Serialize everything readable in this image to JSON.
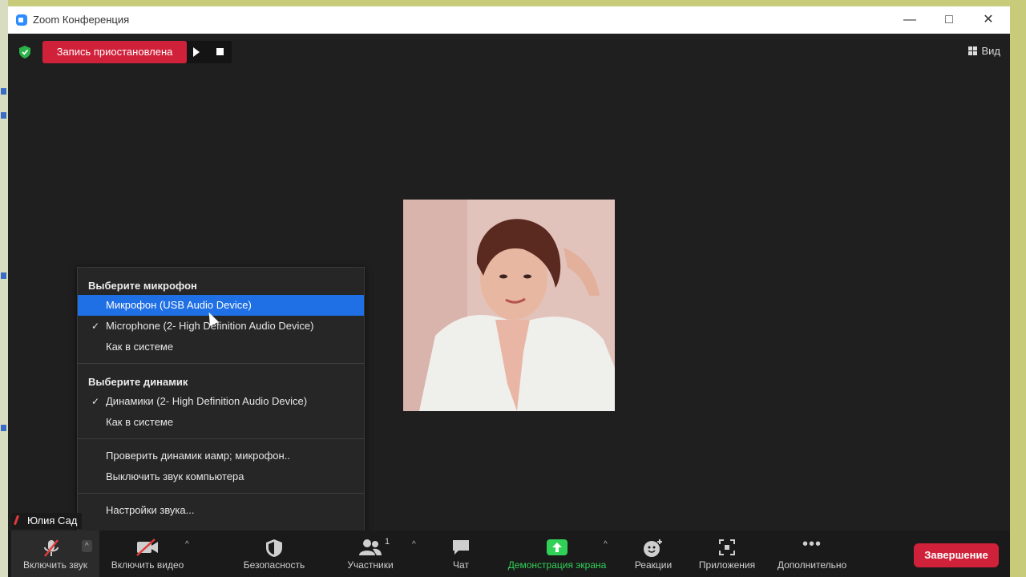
{
  "window": {
    "title": "Zoom Конференция"
  },
  "top_bar": {
    "recording_status": "Запись приостановлена",
    "view_label": "Вид"
  },
  "participant": {
    "name": "Юлия Сад"
  },
  "audio_menu": {
    "mic_header": "Выберите микрофон",
    "mic_options": [
      {
        "label": "Микрофон (USB Audio Device)",
        "selected": true,
        "checked": false
      },
      {
        "label": "Microphone (2- High Definition Audio Device)",
        "selected": false,
        "checked": true
      },
      {
        "label": "Как в системе",
        "selected": false,
        "checked": false
      }
    ],
    "speaker_header": "Выберите динамик",
    "speaker_options": [
      {
        "label": "Динамики (2- High Definition Audio Device)",
        "checked": true
      },
      {
        "label": "Как в системе",
        "checked": false
      }
    ],
    "test_label": "Проверить динамик иамр; микрофон..",
    "mute_computer_label": "Выключить звук компьютера",
    "settings_label": "Настройки звука...",
    "check_mark": "✓"
  },
  "toolbar": {
    "unmute": "Включить звук",
    "start_video": "Включить видео",
    "security": "Безопасность",
    "participants": "Участники",
    "participants_count": "1",
    "chat": "Чат",
    "share_screen": "Демонстрация экрана",
    "reactions": "Реакции",
    "apps": "Приложения",
    "more": "Дополнительно",
    "end": "Завершение"
  },
  "colors": {
    "recording_red": "#d0213a",
    "selection_blue": "#1f6fe5",
    "share_green": "#31d158",
    "background": "#1f1f1f"
  }
}
